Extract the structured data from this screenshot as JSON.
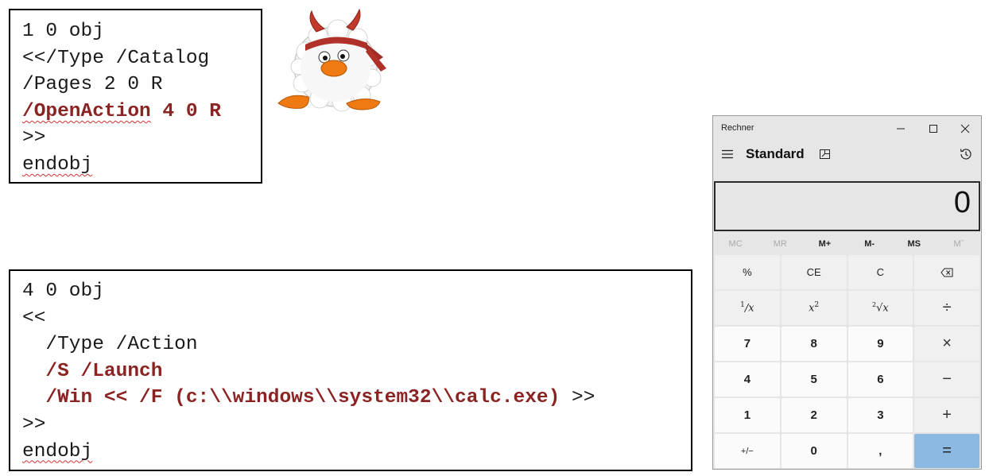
{
  "code_box_1": {
    "line1": "1 0 obj",
    "line2": "<</Type /Catalog",
    "line3": "/Pages 2 0 R",
    "line4_keyword": "/OpenAction",
    "line4_rest": " 4 0 R",
    "line5": ">>",
    "line6": "endobj"
  },
  "code_box_2": {
    "line1": "4 0 obj",
    "line2": "<<",
    "line3": "  /Type /Action",
    "line4_indent": "  ",
    "line4": "/S /Launch",
    "line5_indent": "  ",
    "line5_hl": "/Win << /F (c:\\\\windows\\\\system32\\\\calc.exe)",
    "line5_rest": " >>",
    "line6": ">>",
    "line7": "endobj"
  },
  "calculator": {
    "app_title": "Rechner",
    "mode": "Standard",
    "display": "0",
    "memory": [
      "MC",
      "MR",
      "M+",
      "M-",
      "MS",
      "Mˇ"
    ],
    "memory_enabled": [
      false,
      false,
      true,
      true,
      true,
      false
    ],
    "keys": {
      "percent": "%",
      "clear_entry": "CE",
      "clear": "C",
      "reciprocal_num": "1",
      "reciprocal_den": "x",
      "square_base": "x",
      "square_exp": "2",
      "sqrt_index": "2",
      "sqrt_var": "x",
      "divide": "÷",
      "d7": "7",
      "d8": "8",
      "d9": "9",
      "multiply": "×",
      "d4": "4",
      "d5": "5",
      "d6": "6",
      "minus": "−",
      "d1": "1",
      "d2": "2",
      "d3": "3",
      "plus": "+",
      "negate": "+/−",
      "d0": "0",
      "decimal": ",",
      "equals": "="
    },
    "colors": {
      "equals_key": "#8cb9e1",
      "keyword_red": "#8b2323",
      "window_bg": "#e6e6e6"
    }
  }
}
